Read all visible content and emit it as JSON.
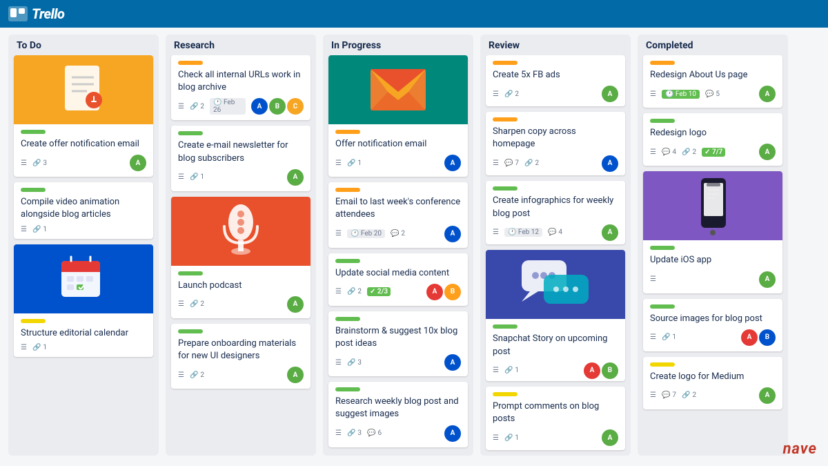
{
  "app": {
    "name": "Trello"
  },
  "columns": [
    {
      "id": "todo",
      "title": "To Do",
      "cards": [
        {
          "id": "todo-1",
          "hasImage": true,
          "imageType": "doc",
          "label": "green",
          "title": "Create offer notification email",
          "meta": {
            "menu": true,
            "attachments": "3",
            "comments": null,
            "date": null,
            "avatars": [
              "#5aac44"
            ]
          }
        },
        {
          "id": "todo-2",
          "hasImage": false,
          "label": "green",
          "title": "Compile video animation alongside blog articles",
          "meta": {
            "menu": true,
            "attachments": "1",
            "comments": null,
            "date": null,
            "avatars": []
          }
        },
        {
          "id": "todo-3",
          "hasImage": true,
          "imageType": "calendar",
          "label": "yellow",
          "title": "Structure editorial calendar",
          "meta": {
            "menu": true,
            "attachments": "1",
            "comments": null,
            "date": null,
            "avatars": []
          }
        }
      ]
    },
    {
      "id": "research",
      "title": "Research",
      "cards": [
        {
          "id": "res-1",
          "hasImage": false,
          "label": "orange",
          "title": "Check all internal URLs work in blog archive",
          "meta": {
            "menu": true,
            "attachments": "2",
            "comments": null,
            "date": "Feb 26",
            "avatars": [
              "#0052cc",
              "#5aac44",
              "#f6a623"
            ]
          }
        },
        {
          "id": "res-2",
          "hasImage": false,
          "label": "green",
          "title": "Create e-mail newsletter for blog subscribers",
          "meta": {
            "menu": true,
            "attachments": "1",
            "comments": null,
            "date": null,
            "avatars": [
              "#5aac44"
            ]
          }
        },
        {
          "id": "res-3",
          "hasImage": true,
          "imageType": "mic",
          "label": "green",
          "title": "Launch podcast",
          "meta": {
            "menu": true,
            "attachments": "2",
            "comments": null,
            "date": null,
            "avatars": [
              "#5aac44"
            ]
          }
        },
        {
          "id": "res-4",
          "hasImage": false,
          "label": "green",
          "title": "Prepare onboarding materials for new UI designers",
          "meta": {
            "menu": true,
            "attachments": "2",
            "comments": null,
            "date": null,
            "avatars": [
              "#5aac44"
            ]
          }
        }
      ]
    },
    {
      "id": "inprogress",
      "title": "In Progress",
      "cards": [
        {
          "id": "ip-1",
          "hasImage": true,
          "imageType": "email",
          "label": "orange",
          "title": "Offer notification email",
          "meta": {
            "menu": true,
            "attachments": "1",
            "comments": null,
            "date": null,
            "avatars": [
              "#0052cc"
            ]
          }
        },
        {
          "id": "ip-2",
          "hasImage": false,
          "label": "orange",
          "title": "Email to last week's conference attendees",
          "date": "Feb 20",
          "meta": {
            "menu": true,
            "attachments": null,
            "comments": "2",
            "date": "Feb 20",
            "avatars": [
              "#0052cc"
            ]
          }
        },
        {
          "id": "ip-3",
          "hasImage": false,
          "label": "green",
          "title": "Update social media content",
          "meta": {
            "menu": true,
            "attachments": "2",
            "comments": null,
            "checklist": "2/3",
            "avatars": [
              "#e53935",
              "#ff9f1a"
            ]
          }
        },
        {
          "id": "ip-4",
          "hasImage": false,
          "label": "green",
          "title": "Brainstorm & suggest 10x blog post ideas",
          "meta": {
            "menu": true,
            "attachments": "3",
            "comments": null,
            "date": null,
            "avatars": [
              "#0052cc"
            ]
          }
        },
        {
          "id": "ip-5",
          "hasImage": false,
          "label": "green",
          "title": "Research weekly blog post and suggest images",
          "meta": {
            "menu": true,
            "attachments": "3",
            "comments": "6",
            "date": null,
            "avatars": [
              "#0052cc"
            ]
          }
        }
      ]
    },
    {
      "id": "review",
      "title": "Review",
      "cards": [
        {
          "id": "rev-1",
          "hasImage": false,
          "label": "orange",
          "title": "Create 5x FB ads",
          "meta": {
            "menu": true,
            "attachments": "2",
            "comments": null,
            "date": null,
            "avatars": [
              "#5aac44"
            ]
          }
        },
        {
          "id": "rev-2",
          "hasImage": false,
          "label": "orange",
          "title": "Sharpen copy across homepage",
          "meta": {
            "menu": true,
            "attachments": "2",
            "comments": "7",
            "date": null,
            "avatars": [
              "#0052cc"
            ]
          }
        },
        {
          "id": "rev-3",
          "hasImage": false,
          "label": "green",
          "title": "Create infographics for weekly blog post",
          "meta": {
            "menu": true,
            "attachments": null,
            "comments": "4",
            "date": "Feb 12",
            "avatars": [
              "#5aac44"
            ]
          }
        },
        {
          "id": "rev-4",
          "hasImage": true,
          "imageType": "chat",
          "label": "green",
          "title": "Snapchat Story on upcoming post",
          "meta": {
            "menu": true,
            "attachments": "1",
            "comments": null,
            "date": null,
            "avatars": [
              "#e53935",
              "#5aac44"
            ]
          }
        },
        {
          "id": "rev-5",
          "hasImage": false,
          "label": "yellow",
          "title": "Prompt comments on blog posts",
          "meta": {
            "menu": true,
            "attachments": "1",
            "comments": null,
            "date": null,
            "avatars": [
              "#5aac44"
            ]
          }
        }
      ]
    },
    {
      "id": "completed",
      "title": "Completed",
      "cards": [
        {
          "id": "comp-1",
          "hasImage": false,
          "label": "orange",
          "title": "Redesign About Us page",
          "dateBadge": "Feb 10",
          "dateBadgeColor": "green",
          "meta": {
            "menu": true,
            "attachments": null,
            "comments": "5",
            "date": "Feb 10",
            "avatars": [
              "#5aac44"
            ]
          }
        },
        {
          "id": "comp-2",
          "hasImage": false,
          "label": "green",
          "title": "Redesign logo",
          "checklist": "7/7",
          "meta": {
            "menu": true,
            "attachments": "2",
            "comments": "4",
            "date": null,
            "avatars": [
              "#5aac44"
            ]
          }
        },
        {
          "id": "comp-3",
          "hasImage": true,
          "imageType": "phone",
          "label": "green",
          "title": "Update iOS app",
          "meta": {
            "menu": true,
            "attachments": null,
            "comments": null,
            "date": null,
            "avatars": [
              "#5aac44"
            ]
          }
        },
        {
          "id": "comp-4",
          "hasImage": false,
          "label": "green",
          "title": "Source images for blog post",
          "meta": {
            "menu": true,
            "attachments": "1",
            "comments": null,
            "date": null,
            "avatars": [
              "#e53935",
              "#0052cc"
            ]
          }
        },
        {
          "id": "comp-5",
          "hasImage": false,
          "label": "yellow",
          "title": "Create logo for Medium",
          "meta": {
            "menu": true,
            "attachments": "2",
            "comments": "7",
            "date": null,
            "avatars": [
              "#5aac44"
            ]
          }
        }
      ]
    }
  ],
  "nave": "nave"
}
